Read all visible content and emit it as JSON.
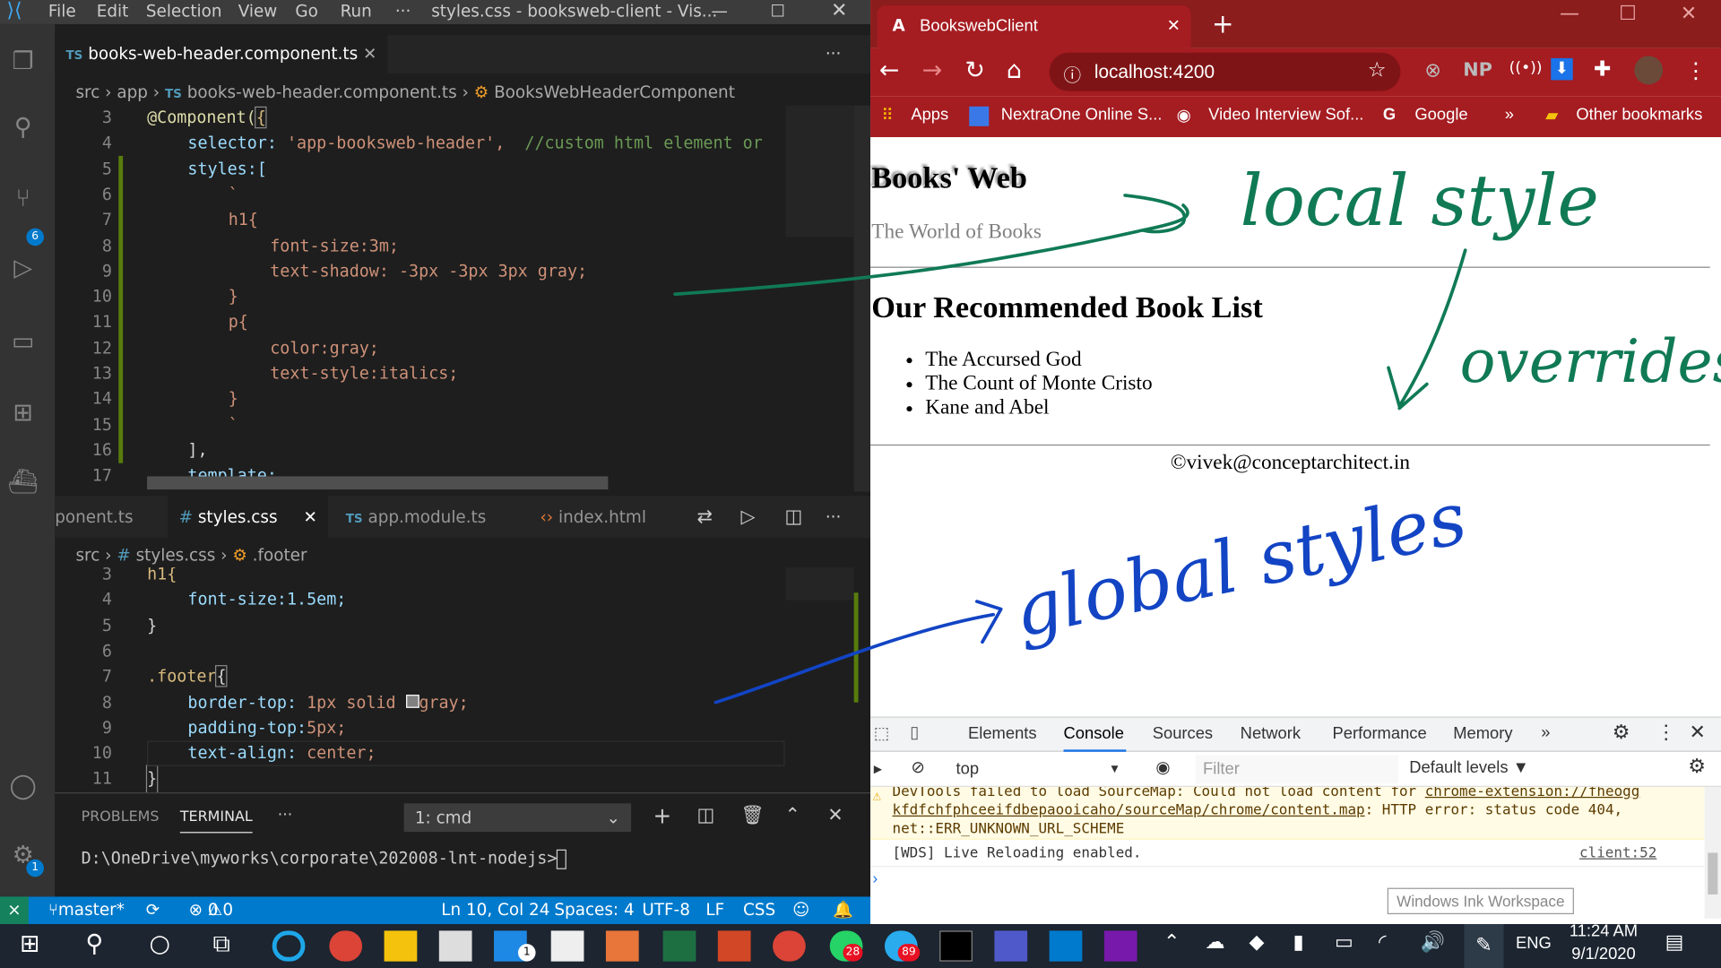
{
  "vscode": {
    "menu": [
      "File",
      "Edit",
      "Selection",
      "View",
      "Go",
      "Run",
      "···"
    ],
    "title": "styles.css - booksweb-client - Vis...",
    "top_tab": "books-web-header.component.ts",
    "top_crumb": [
      "src",
      "app",
      "books-web-header.component.ts",
      "BooksWebHeaderComponent"
    ],
    "top_lines": [
      "3",
      "4",
      "5",
      "6",
      "7",
      "8",
      "9",
      "10",
      "11",
      "12",
      "13",
      "14",
      "15",
      "16",
      "17"
    ],
    "top_code": {
      "l3a": "@Component(",
      "l3b": "{",
      "l4k": "selector:",
      "l4s": "'app-booksweb-header',",
      "l4c": "//custom html element or",
      "l5": "styles:[",
      "l6": "`",
      "l7": "h1{",
      "l8": "font-size:3m;",
      "l9": "text-shadow: -3px -3px 3px gray;",
      "l10": "}",
      "l11": "p{",
      "l12": "color:gray;",
      "l13": "text-style:italics;",
      "l14": "}",
      "l15": "`",
      "l16": "],",
      "l17": "template:"
    },
    "bottom_tabs": [
      "ponent.ts",
      "styles.css",
      "app.module.ts",
      "index.html"
    ],
    "bottom_crumb": [
      "src",
      "styles.css",
      ".footer"
    ],
    "bottom_lines": [
      "3",
      "4",
      "5",
      "6",
      "7",
      "8",
      "9",
      "10",
      "11"
    ],
    "bottom_code": {
      "l3": "h1{",
      "l4": "font-size:1.5em;",
      "l5": "}",
      "l7a": ".footer",
      "l7b": "{",
      "l8k": "border-top:",
      "l8v": "1px solid",
      "l8c": "gray;",
      "l9k": "padding-top:",
      "l9v": "5px;",
      "l10k": "text-align:",
      "l10v": "center;",
      "l11": "}"
    },
    "panel_tabs": [
      "PROBLEMS",
      "TERMINAL",
      "···"
    ],
    "terminal_select": "1: cmd",
    "terminal_line": "D:\\OneDrive\\myworks\\corporate\\202008-lnt-nodejs>",
    "status": {
      "branch": "master*",
      "errors": "0",
      "warnings": "0",
      "position": "Ln 10, Col 24",
      "spaces": "Spaces: 4",
      "encoding": "UTF-8",
      "eol": "LF",
      "lang": "CSS"
    },
    "badges": {
      "scm": "6",
      "settings": "1"
    }
  },
  "browser": {
    "tab_title": "BookswebClient",
    "url": "localhost:4200",
    "ext_np": "NP",
    "bookmarks": [
      "Apps",
      "NextraOne Online S...",
      "Video Interview Sof...",
      "Google",
      "»",
      "Other bookmarks"
    ],
    "page": {
      "h1": "Books' Web",
      "tagline": "The World of Books",
      "h2": "Our Recommended Book List",
      "books": [
        "The Accursed God",
        "The Count of Monte Cristo",
        "Kane and Abel"
      ],
      "footer": "©vivek@conceptarchitect.in"
    },
    "annotations": {
      "top": "local style",
      "mid": "overrides",
      "bottom": "global styles"
    },
    "devtools": {
      "tabs": [
        "Elements",
        "Console",
        "Sources",
        "Network",
        "Performance",
        "Memory",
        "»"
      ],
      "context": "top",
      "filter_placeholder": "Filter",
      "levels": "Default levels ▼",
      "warn1": "DevTools failed to load SourceMap: Could not load content for",
      "warn1_link": "chrome-extension://fheogg",
      "warn2_link": "kfdfchfphceeifdbepaooicaho/sourceMap/chrome/content.map",
      "warn2_rest": ": HTTP error: status code 404,",
      "warn3": "net::ERR_UNKNOWN_URL_SCHEME",
      "log": "[WDS] Live Reloading enabled.",
      "log_src": "client:52",
      "tooltip": "Windows Ink Workspace"
    }
  },
  "taskbar": {
    "lang": "ENG",
    "time": "11:24 AM",
    "date": "9/1/2020",
    "badges": [
      "1",
      "28",
      "89"
    ]
  }
}
